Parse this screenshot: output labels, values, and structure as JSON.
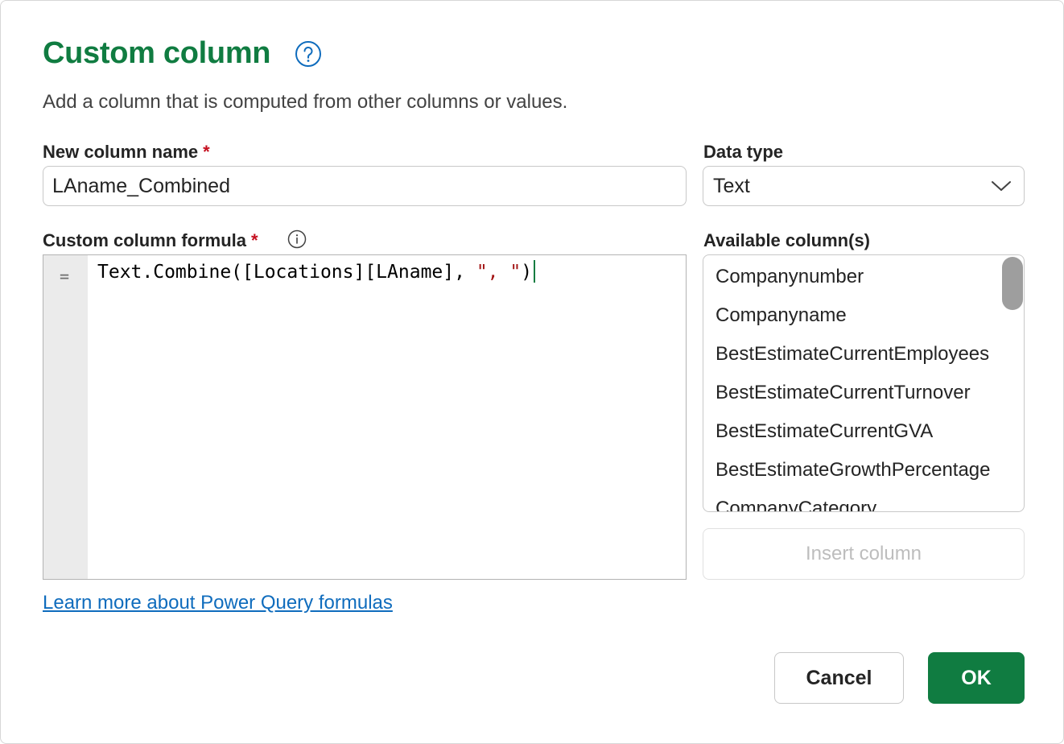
{
  "dialog": {
    "title": "Custom column",
    "subtitle": "Add a column that is computed from other columns or values."
  },
  "name_field": {
    "label": "New column name",
    "required_mark": "*",
    "value": "LAname_Combined"
  },
  "data_type": {
    "label": "Data type",
    "selected": "Text"
  },
  "formula": {
    "label": "Custom column formula",
    "required_mark": "*",
    "gutter_symbol": "=",
    "code_prefix": "Text.Combine([Locations][LAname], ",
    "code_string": "\", \"",
    "code_suffix": ")"
  },
  "available_columns": {
    "label": "Available column(s)",
    "items": [
      "Companynumber",
      "Companyname",
      "BestEstimateCurrentEmployees",
      "BestEstimateCurrentTurnover",
      "BestEstimateCurrentGVA",
      "BestEstimateGrowthPercentage",
      "CompanyCategory"
    ]
  },
  "buttons": {
    "insert_column": "Insert column",
    "cancel": "Cancel",
    "ok": "OK"
  },
  "learn_more_link": "Learn more about Power Query formulas",
  "colors": {
    "accent": "#107c41",
    "link": "#0f6cbd",
    "required": "#c50f1f",
    "string_literal": "#a31515"
  }
}
